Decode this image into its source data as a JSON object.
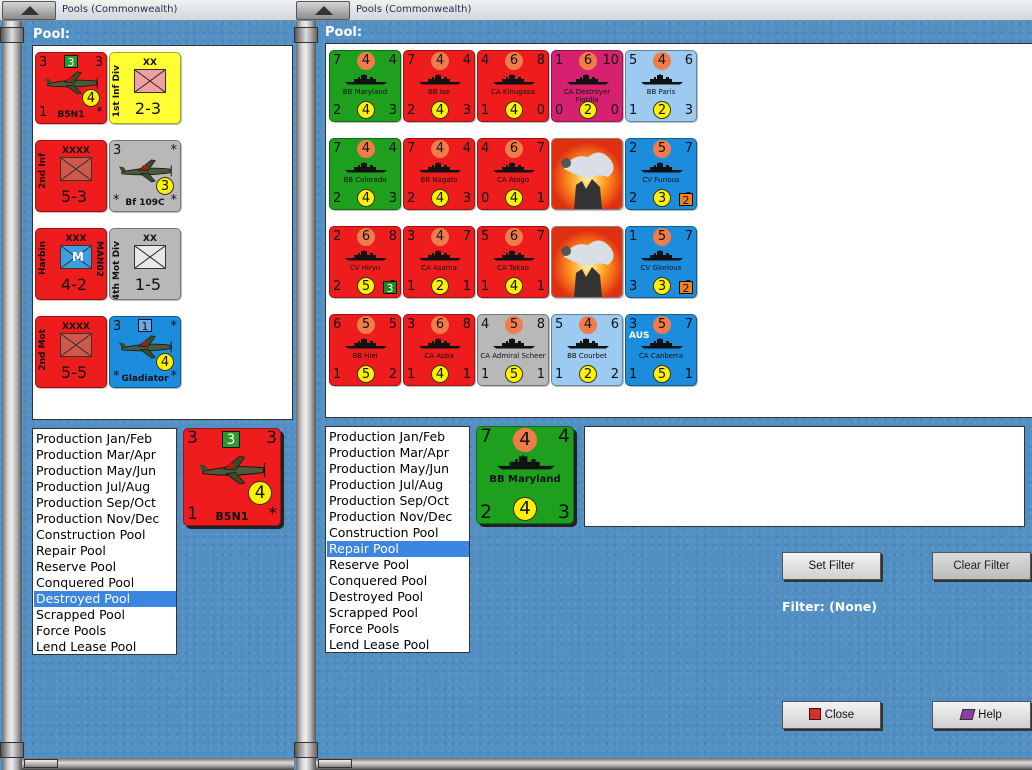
{
  "left_window": {
    "title": "Pools (Commonwealth)",
    "pool_label": "Pool:",
    "list": [
      "Production Jan/Feb",
      "Production Mar/Apr",
      "Production May/Jun",
      "Production Jul/Aug",
      "Production Sep/Oct",
      "Production Nov/Dec",
      "Construction Pool",
      "Repair Pool",
      "Reserve Pool",
      "Conquered Pool",
      "Destroyed Pool",
      "Scrapped Pool",
      "Force Pools",
      "Lend Lease Pool"
    ],
    "selected": "Destroyed Pool",
    "units": [
      {
        "kind": "air",
        "name": "B5N1",
        "tl": "3",
        "badge": "3",
        "tr": "3",
        "bl": "1",
        "yc": "4",
        "br": "*",
        "color": "#ee1c1c"
      },
      {
        "kind": "land",
        "name": "1st Inf Div",
        "size": "XX",
        "str": "2-3",
        "color": "#ffff33"
      },
      {
        "kind": "land",
        "name": "2nd Inf",
        "size": "XXXX",
        "str": "5-3",
        "color": "#ee1c1c"
      },
      {
        "kind": "air",
        "name": "Bf 109C",
        "tl": "3",
        "badge": "",
        "tr": "*",
        "bl": "*",
        "yc": "3",
        "br": "*",
        "color": "#b8b8b8"
      },
      {
        "kind": "land",
        "name": "Harbin",
        "name2": "MAN02",
        "size": "XXX",
        "str": "4-2",
        "color": "#ee1c1c",
        "mark": "M"
      },
      {
        "kind": "land",
        "name": "4th Mot Div",
        "size": "XX",
        "str": "1-5",
        "color": "#b8b8b8"
      },
      {
        "kind": "land",
        "name": "2nd Mot",
        "size": "XXXX",
        "str": "5-5",
        "color": "#ee1c1c"
      },
      {
        "kind": "air",
        "name": "Gladiator",
        "tl": "3",
        "badge": "1",
        "tr": "*",
        "bl": "*",
        "yc": "4",
        "br": "*",
        "color": "#1c8cdc"
      }
    ],
    "preview": {
      "name": "B5N1",
      "tl": "3",
      "badge": "3",
      "tr": "3",
      "bl": "1",
      "yc": "4",
      "br": "*"
    }
  },
  "right_window": {
    "title": "Pools (Commonwealth)",
    "pool_label": "Pool:",
    "list": [
      "Production Jan/Feb",
      "Production Mar/Apr",
      "Production May/Jun",
      "Production Jul/Aug",
      "Production Sep/Oct",
      "Production Nov/Dec",
      "Construction Pool",
      "Repair Pool",
      "Reserve Pool",
      "Conquered Pool",
      "Destroyed Pool",
      "Scrapped Pool",
      "Force Pools",
      "Lend Lease Pool"
    ],
    "selected": "Repair Pool",
    "units": [
      {
        "name": "BB Maryland",
        "tl": "7",
        "oc": "4",
        "tr": "4",
        "bl": "2",
        "yc": "4",
        "br": "3",
        "color": "#1ea01e"
      },
      {
        "name": "BB Ise",
        "tl": "7",
        "oc": "4",
        "tr": "4",
        "bl": "2",
        "yc": "4",
        "br": "3",
        "color": "#ee1c1c"
      },
      {
        "name": "CA Kinugasa",
        "tl": "4",
        "oc": "6",
        "tr": "8",
        "bl": "1",
        "yc": "4",
        "br": "0",
        "color": "#ee1c1c"
      },
      {
        "name": "CA Destroyer Flotilla",
        "tl": "1",
        "oc": "6",
        "tr": "10",
        "bl": "0",
        "yc": "2",
        "br": "0",
        "color": "#d62070"
      },
      {
        "name": "BB Paris",
        "tl": "5",
        "oc": "4",
        "tr": "6",
        "bl": "1",
        "yc": "2",
        "br": "3",
        "color": "#9ccaf0"
      },
      {
        "name": "BB Colorado",
        "tl": "7",
        "oc": "4",
        "tr": "4",
        "bl": "2",
        "yc": "4",
        "br": "3",
        "color": "#1ea01e"
      },
      {
        "name": "BB Nagato",
        "tl": "7",
        "oc": "4",
        "tr": "4",
        "bl": "2",
        "yc": "4",
        "br": "3",
        "color": "#ee1c1c"
      },
      {
        "name": "CA Atago",
        "tl": "4",
        "oc": "6",
        "tr": "7",
        "bl": "0",
        "yc": "4",
        "br": "1",
        "color": "#ee1c1c"
      },
      {
        "name": "",
        "kind": "explosion",
        "color": "#c8c8c8"
      },
      {
        "name": "CV Furious",
        "tl": "2",
        "oc": "5",
        "tr": "7",
        "bl": "2",
        "yc": "3",
        "br": "2",
        "color": "#1c8cdc",
        "box": "orange"
      },
      {
        "name": "CV Hiryu",
        "tl": "2",
        "oc": "6",
        "tr": "8",
        "bl": "2",
        "yc": "5",
        "br": "3",
        "color": "#ee1c1c",
        "box": "green"
      },
      {
        "name": "CA Asama",
        "tl": "3",
        "oc": "4",
        "tr": "7",
        "bl": "1",
        "yc": "2",
        "br": "1",
        "color": "#ee1c1c"
      },
      {
        "name": "CA Takao",
        "tl": "5",
        "oc": "6",
        "tr": "7",
        "bl": "1",
        "yc": "4",
        "br": "1",
        "color": "#ee1c1c"
      },
      {
        "name": "",
        "kind": "explosion",
        "color": "#c8c8c8"
      },
      {
        "name": "CV Glorious",
        "tl": "1",
        "oc": "5",
        "tr": "7",
        "bl": "3",
        "yc": "3",
        "br": "2",
        "color": "#1c8cdc",
        "box": "orange"
      },
      {
        "name": "BB Hiei",
        "tl": "6",
        "oc": "5",
        "tr": "5",
        "bl": "1",
        "yc": "5",
        "br": "2",
        "color": "#ee1c1c"
      },
      {
        "name": "CA Aoba",
        "tl": "3",
        "oc": "6",
        "tr": "8",
        "bl": "1",
        "yc": "4",
        "br": "1",
        "color": "#ee1c1c"
      },
      {
        "name": "CA Admiral Scheer",
        "tl": "4",
        "oc": "5",
        "tr": "8",
        "bl": "1",
        "yc": "5",
        "br": "1",
        "color": "#b8b8b8"
      },
      {
        "name": "BB Courbet",
        "tl": "5",
        "oc": "4",
        "tr": "6",
        "bl": "1",
        "yc": "2",
        "br": "2",
        "color": "#9ccaf0"
      },
      {
        "name": "CA Canberra",
        "tl": "3",
        "oc": "5",
        "tr": "7",
        "bl": "1",
        "yc": "5",
        "br": "1",
        "color": "#1c8cdc",
        "aus": "AUS"
      }
    ],
    "preview": {
      "name": "BB Maryland",
      "tl": "7",
      "oc": "4",
      "tr": "4",
      "bl": "2",
      "yc": "4",
      "br": "3"
    },
    "set_filter": "Set Filter",
    "clear_filter": "Clear Filter",
    "filter_text": "Filter: (None)",
    "close": "Close",
    "help": "Help"
  }
}
